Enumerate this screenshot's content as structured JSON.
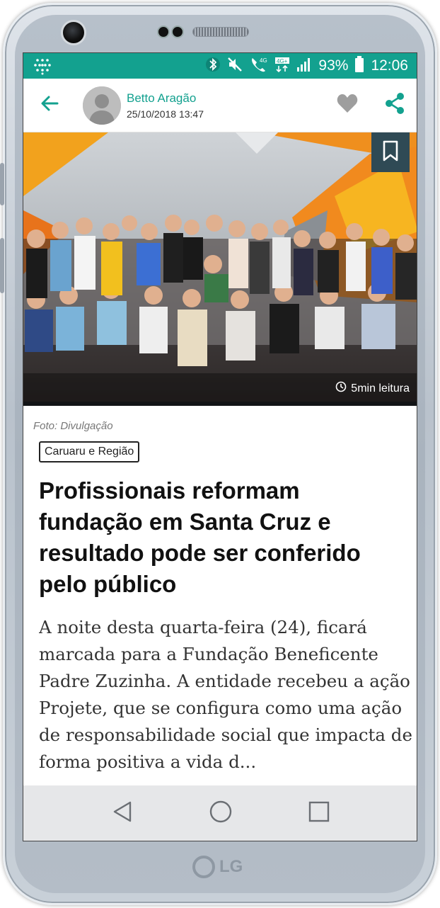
{
  "status_bar": {
    "battery": "93%",
    "time": "12:06",
    "network_label": "4G"
  },
  "app_bar": {
    "author_name": "Betto Aragão",
    "post_date": "25/10/2018 13:47"
  },
  "hero": {
    "read_time": "5min leitura"
  },
  "article": {
    "photo_caption": "Foto: Divulgação",
    "category": "Caruaru e Região",
    "headline": "Profissionais reformam fundação em Santa Cruz e resultado pode ser conferido pelo público",
    "body": "A noite desta quarta-feira (24), ficará marcada para a Fundação Beneficente Padre Zuzinha. A entidade recebeu a ação Projete, que se configura como uma ação de responsabilidade social que impacta de forma positiva a vida d..."
  },
  "device": {
    "brand": "LG"
  },
  "colors": {
    "accent": "#13a18f",
    "bookmark_bg": "#2f4a55",
    "nav_bg": "#e6e7e9"
  },
  "icons": [
    "app-grid-icon",
    "bluetooth-icon",
    "mute-icon",
    "volte-call-icon",
    "lte-icon",
    "signal-icon",
    "battery-icon",
    "back-arrow-icon",
    "avatar-icon",
    "heart-icon",
    "share-icon",
    "bookmark-icon",
    "clock-icon",
    "nav-back-icon",
    "nav-home-icon",
    "nav-recents-icon"
  ]
}
